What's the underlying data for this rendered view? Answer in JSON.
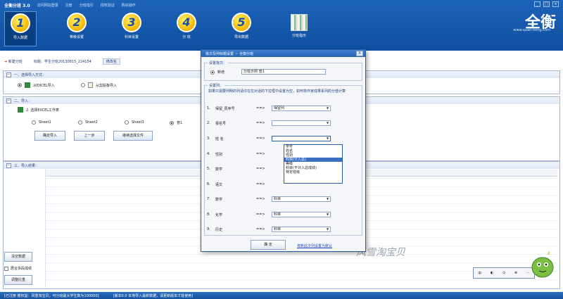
{
  "app": {
    "title": "全衡分班 3.0",
    "links": [
      "访问网站登录",
      "注册",
      "分班指引",
      "授权验证",
      "购买操作"
    ],
    "window_buttons": [
      "_",
      "□",
      "×"
    ],
    "logo": "全衡",
    "logo_sub": "www.quan-heng.com"
  },
  "toolbar": [
    {
      "num": "1",
      "label": "导入数据",
      "active": true
    },
    {
      "num": "2",
      "label": "等级设置",
      "active": false
    },
    {
      "num": "3",
      "label": "科目设置",
      "active": false
    },
    {
      "num": "4",
      "label": "分 班",
      "active": false
    },
    {
      "num": "5",
      "label": "导出数据",
      "active": false
    },
    {
      "num": "",
      "label": "分班指示",
      "active": false,
      "icon": "books-icon"
    }
  ],
  "infobar": {
    "new_label": "新建分班",
    "title_label": "标题：学生分班20130815_224154",
    "note": "修改名"
  },
  "section1": {
    "title": "一、选择导入方式：",
    "opt_excel": "从EXCEL导入",
    "opt_paste": "从剪贴板导入"
  },
  "section2": {
    "title": "二、导入：",
    "subtitle": "2. 选择EXCEL工作表",
    "sheets": [
      "Sheet1",
      "Sheet2",
      "Sheet3",
      "普1"
    ],
    "btn_import": "确定导入",
    "btn_prev": "上一步",
    "btn_choose": "继续选择文件"
  },
  "section3": {
    "title": "三、导入结果："
  },
  "left_tools": {
    "clear": "清空数据",
    "multi": "居合多段成绩",
    "adjust": "调整比重"
  },
  "statusbar": {
    "left": "[已注册 赠权益：风雪淘宝贝，可分班最大学生数为100000]",
    "right": "[版本0.0 本地导入最新数据，请更新版本才能使用]"
  },
  "watermark": "风雪淘宝贝",
  "dialog": {
    "title": "批次及列标题设置 － 全衡分班",
    "close": "X",
    "batch_legend": "设置批次：",
    "batch_radio": "新增",
    "batch_value": "分班示例 普1",
    "col_legend": "设置列：",
    "hint": "如果只需要列明的列请仔在在对话的下拉框中设置为空，如何将作家成果系列的分值计算",
    "rows": [
      {
        "num": "1.",
        "field": "保留_原序号",
        "arrow": "==>",
        "value": "保留列"
      },
      {
        "num": "2.",
        "field": "报名号",
        "arrow": "==>",
        "value": ""
      },
      {
        "num": "3.",
        "field": "姓 名",
        "arrow": "==>",
        "value": ""
      },
      {
        "num": "4.",
        "field": "性别",
        "arrow": "==>",
        "value": ""
      },
      {
        "num": "5.",
        "field": "数学",
        "arrow": "==>",
        "value": ""
      },
      {
        "num": "6.",
        "field": "语文",
        "arrow": "==>",
        "value": ""
      },
      {
        "num": "7.",
        "field": "数学",
        "arrow": "==>",
        "value": "科目"
      },
      {
        "num": "8.",
        "field": "化学",
        "arrow": "==>",
        "value": "科目"
      },
      {
        "num": "9.",
        "field": "历史",
        "arrow": "==>",
        "value": "科目"
      }
    ],
    "ok": "确 定",
    "save_link": "将新此次列设置为默认"
  },
  "dropdown": {
    "options": [
      "学号",
      "姓名",
      "性别",
      "科目(计入总)",
      "等级",
      "科目(不计入总成绩)",
      "特定班级"
    ],
    "selected_index": 3
  },
  "media": [
    "中",
    "◐",
    "⊙",
    "⊕",
    "⋯"
  ]
}
